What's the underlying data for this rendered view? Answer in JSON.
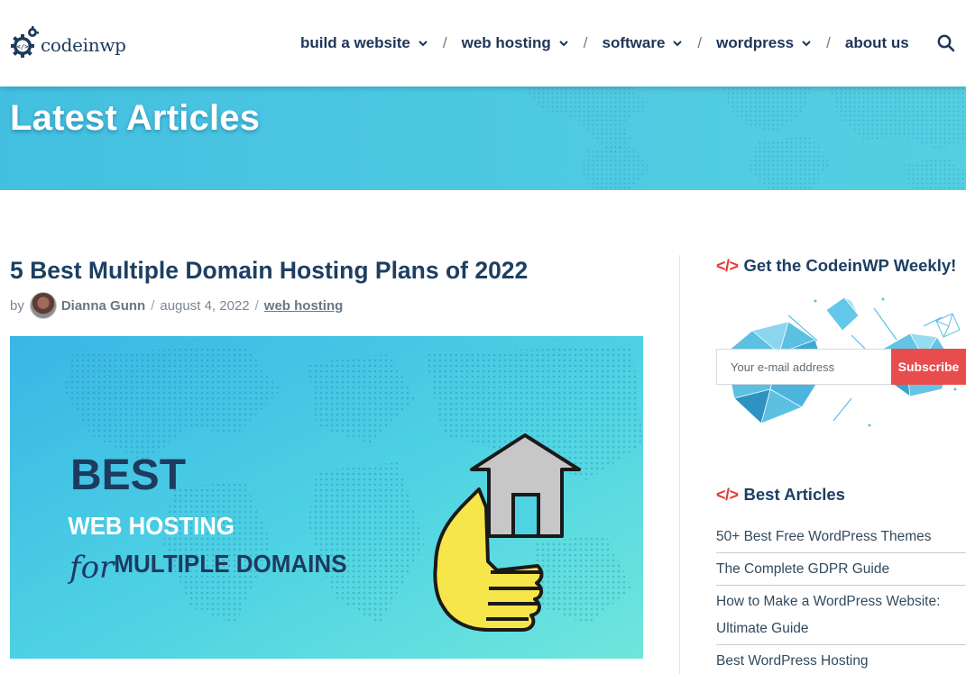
{
  "header": {
    "logo_text": "codeinwp",
    "nav": [
      {
        "label": "build a website",
        "has_dropdown": true
      },
      {
        "label": "web hosting",
        "has_dropdown": true
      },
      {
        "label": "software",
        "has_dropdown": true
      },
      {
        "label": "wordpress",
        "has_dropdown": true
      },
      {
        "label": "about us",
        "has_dropdown": false
      }
    ],
    "nav_separator": "/",
    "search_icon": "search-icon"
  },
  "hero": {
    "title": "Latest Articles"
  },
  "article": {
    "title": "5 Best Multiple Domain Hosting Plans of 2022",
    "meta": {
      "by": "by",
      "author": "Dianna Gunn",
      "sep": "/",
      "date": "august 4, 2022",
      "category": "web hosting"
    },
    "image_text": {
      "line1": "BEST",
      "line2": "WEB HOSTING",
      "line3_script": "for",
      "line3": "MULTIPLE DOMAINS"
    }
  },
  "sidebar": {
    "code_symbol": "</>",
    "newsletter": {
      "title": "Get the CodeinWP Weekly!",
      "email_placeholder": "Your e-mail address",
      "subscribe_label": "Subscribe"
    },
    "best_articles": {
      "title": "Best Articles",
      "items": [
        "50+ Best Free WordPress Themes",
        "The Complete GDPR Guide",
        "How to Make a WordPress Website: Ultimate Guide",
        "Best WordPress Hosting"
      ]
    }
  },
  "colors": {
    "brand_navy": "#1d3f63",
    "hero_cyan": "#4cc7e2",
    "accent_red": "#e53935",
    "subscribe_red": "#e84c4c"
  }
}
